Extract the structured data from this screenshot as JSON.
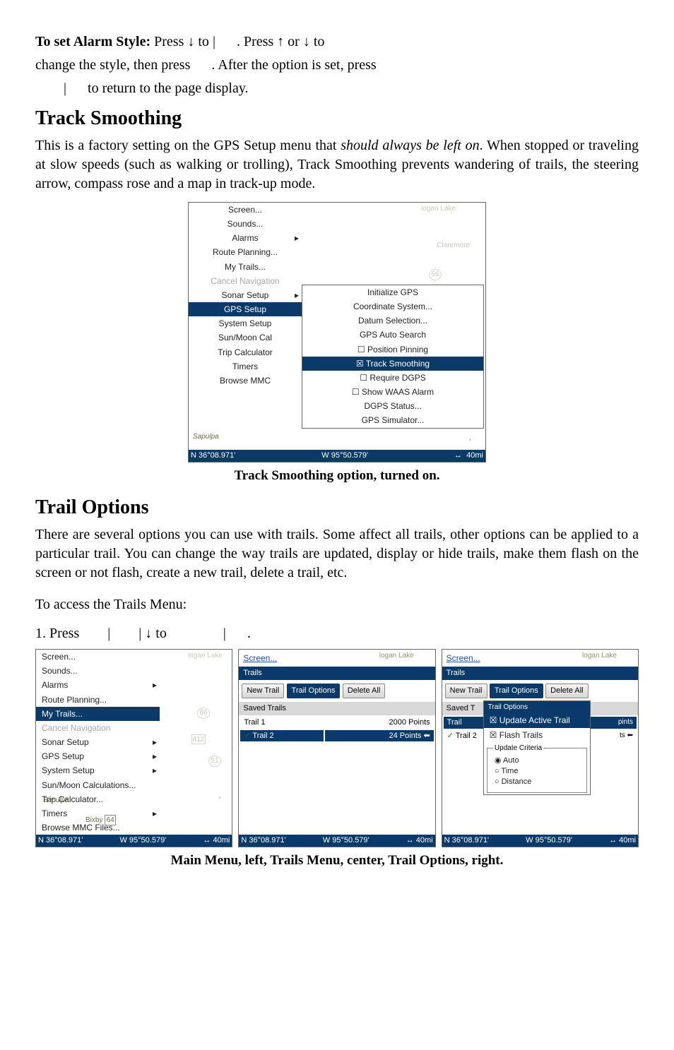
{
  "para_alarm_line1_a": "To set Alarm Style:",
  "para_alarm_line1_b": " Press ↓ to ",
  "para_alarm_line1_c": ". Press ↑ or ↓ to",
  "para_alarm_line2": "change the style, then press ",
  "para_alarm_line2b": ". After the option is set, press",
  "para_alarm_line3": " to return to the page display.",
  "h_track": "Track Smoothing",
  "p_track": "This is a factory setting on the GPS Setup menu that ",
  "p_track_it": "should always be left on",
  "p_track_rest": ". When stopped or traveling at slow speeds (such as walking or trolling), Track Smoothing prevents wandering of trails, the steering arrow, compass rose and a map in track-up mode.",
  "cap_track": "Track Smoothing option, turned on.",
  "h_trail": "Trail Options",
  "p_trail": "There are several options you can use with trails. Some affect all trails, other options can be applied to a particular trail. You can change the way trails are updated, display or hide trails, make them flash on the screen or not flash, create a new trail, delete a trail, etc.",
  "p_access": "To access the Trails Menu:",
  "p_step1a": "1. Press ",
  "p_step1b": "↓ to ",
  "cap_row3": "Main Menu, left, Trails Menu, center, Trail Options, right.",
  "main_menu": [
    {
      "label": "Screen...",
      "sub": false
    },
    {
      "label": "Sounds...",
      "sub": false
    },
    {
      "label": "Alarms",
      "sub": true
    },
    {
      "label": "Route Planning...",
      "sub": false
    },
    {
      "label": "My Trails...",
      "sub": false
    },
    {
      "label": "Cancel Navigation",
      "dim": true
    },
    {
      "label": "Sonar Setup",
      "sub": true
    },
    {
      "label": "GPS Setup",
      "hi": true,
      "sub": true
    },
    {
      "label": "System Setup",
      "sub": true
    },
    {
      "label": "Sun/Moon Calculations...",
      "trunc": "Sun/Moon Cal"
    },
    {
      "label": "Trip Calculator",
      "trunc": "Trip Calculator"
    },
    {
      "label": "Timers",
      "sub": true
    },
    {
      "label": "Browse MMC Files...",
      "trunc": "Browse MMC"
    }
  ],
  "gps_submenu": [
    {
      "label": "Initialize GPS"
    },
    {
      "label": "Coordinate System..."
    },
    {
      "label": "Datum Selection..."
    },
    {
      "label": "GPS Auto Search"
    },
    {
      "label": "Position Pinning",
      "check": false
    },
    {
      "label": "Track Smoothing",
      "check": true,
      "hi": true
    },
    {
      "label": "Require DGPS",
      "check": false
    },
    {
      "label": "Show WAAS Alarm",
      "check": false
    },
    {
      "label": "DGPS Status..."
    },
    {
      "label": "GPS Simulator..."
    }
  ],
  "map_labels": {
    "place1": "logan Lake",
    "place2": "Claremore",
    "hwy": "66",
    "sapulpa": "Sapulpa"
  },
  "statusbar": {
    "lat": "N   36°08.971'",
    "lon": "W   95°50.579'",
    "scale": "40mi",
    "arrow": "↔"
  },
  "row3_left_menu": [
    {
      "label": "Screen..."
    },
    {
      "label": "Sounds..."
    },
    {
      "label": "Alarms",
      "sub": true
    },
    {
      "label": "Route Planning..."
    },
    {
      "label": "My Trails...",
      "hi": true
    },
    {
      "label": "Cancel Navigation",
      "dim": true
    },
    {
      "label": "Sonar Setup",
      "sub": true
    },
    {
      "label": "GPS Setup",
      "sub": true
    },
    {
      "label": "System Setup",
      "sub": true
    },
    {
      "label": "Sun/Moon Calculations..."
    },
    {
      "label": "Trip Calculator..."
    },
    {
      "label": "Timers",
      "sub": true
    },
    {
      "label": "Browse MMC Files..."
    }
  ],
  "row3_left_map": {
    "place1": "logan Lake",
    "hwy1": "66",
    "hwy2": "412",
    "hwy3": "51",
    "bixby": "Bixby",
    "bixby_hwy": "64",
    "sapulpa": "Sapulpa"
  },
  "trails_panel": {
    "screen_link": "Screen...",
    "title": "Trails",
    "btn_new": "New Trail",
    "btn_opts": "Trail Options",
    "btn_delall": "Delete All",
    "saved_label": "Saved Trails",
    "rows": [
      {
        "name": "Trail 1",
        "pts": "2000 Points"
      },
      {
        "name": "Trail 2",
        "pts": "24 Points",
        "hi": true,
        "bolt": "⬅"
      }
    ]
  },
  "trails_panel_right": {
    "saved_label": "Saved T",
    "row1": {
      "name": "Trail",
      "hi": true
    },
    "row2": {
      "name": "Trail 2",
      "check": true
    }
  },
  "trail_options_popup": {
    "title": "Trail Options",
    "opt_update": "Update Active Trail",
    "opt_flash": "Flash Trails",
    "group": "Update Criteria",
    "r_auto": "Auto",
    "r_time": "Time",
    "r_dist": "Distance",
    "side_pints": "pints",
    "side_ts": "ts",
    "side_bolt": "⬅"
  }
}
